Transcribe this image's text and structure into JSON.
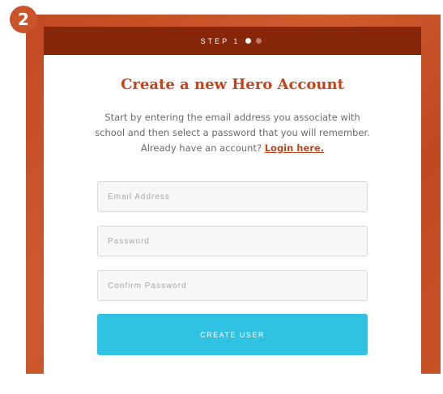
{
  "badge": {
    "number": "2"
  },
  "step_header": {
    "label": "STEP 1",
    "total_steps": 2,
    "current_step": 1
  },
  "form": {
    "title": "Create a new Hero Account",
    "description": "Start by entering the email address you associate with school and then select a password that you will remember. Already have an account?",
    "login_link": "Login here.",
    "email_placeholder": "Email Address",
    "password_placeholder": "Password",
    "confirm_placeholder": "Confirm Password",
    "submit_label": "CREATE USER"
  },
  "colors": {
    "frame": "#c24a22",
    "step_bar": "#86260a",
    "title": "#c1461e",
    "button": "#2fc2e2"
  }
}
